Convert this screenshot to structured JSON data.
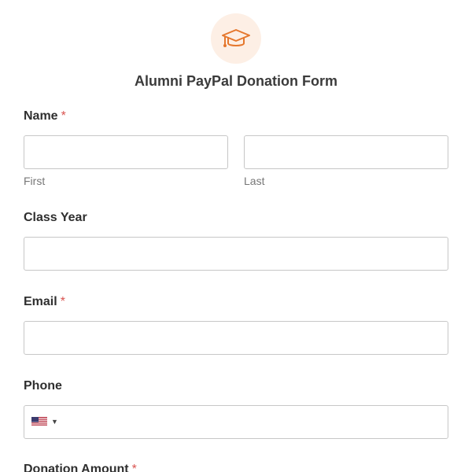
{
  "form": {
    "title": "Alumni PayPal Donation Form",
    "icon": "graduation-cap-icon",
    "accent_color": "#e5772d"
  },
  "fields": {
    "name": {
      "label": "Name",
      "required_mark": "*",
      "first_sublabel": "First",
      "last_sublabel": "Last",
      "first_value": "",
      "last_value": ""
    },
    "class_year": {
      "label": "Class Year",
      "value": ""
    },
    "email": {
      "label": "Email",
      "required_mark": "*",
      "value": ""
    },
    "phone": {
      "label": "Phone",
      "country": "US",
      "value": ""
    },
    "donation_amount": {
      "label": "Donation Amount",
      "required_mark": "*"
    }
  }
}
